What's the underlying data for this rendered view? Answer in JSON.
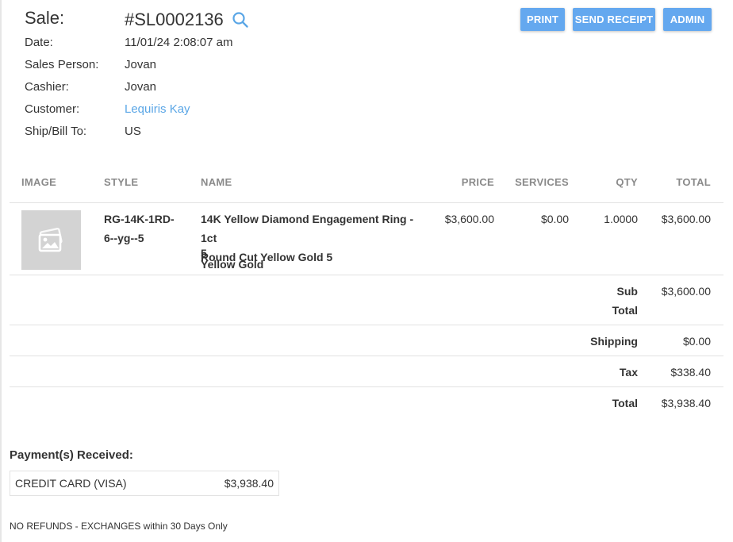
{
  "sale": {
    "label": "Sale:",
    "id": "#SL0002136"
  },
  "details": [
    {
      "key": "Date:",
      "value": "11/01/24 2:08:07 am"
    },
    {
      "key": "Sales Person:",
      "value": "Jovan"
    },
    {
      "key": "Cashier:",
      "value": "Jovan"
    },
    {
      "key": "Customer:",
      "value": "Lequiris Kay"
    },
    {
      "key": "Ship/Bill To:",
      "value": "US"
    }
  ],
  "actions": {
    "print": "PRINT",
    "send_receipt": "SEND RECEIPT",
    "admin": "ADMIN"
  },
  "table": {
    "headers": {
      "image": "IMAGE",
      "style": "STYLE",
      "name": "NAME",
      "price": "PRICE",
      "services": "SERVICES",
      "qty": "QTY",
      "total": "TOTAL"
    },
    "rows": [
      {
        "style_line1": "RG-14K-1RD-",
        "style_line2": "6--yg--5",
        "name_line1": "14K Yellow Diamond Engagement Ring - 1ct",
        "name_line2": "Round Cut Yellow Gold 5",
        "size": "5",
        "metal": "Yellow Gold",
        "price": "$3,600.00",
        "services": "$0.00",
        "qty": "1.0000",
        "total": "$3,600.00"
      }
    ]
  },
  "summary": {
    "subtotal_label_1": "Sub",
    "subtotal_label_2": "Total",
    "subtotal": "$3,600.00",
    "shipping_label": "Shipping",
    "shipping": "$0.00",
    "tax_label": "Tax",
    "tax": "$338.40",
    "total_label": "Total",
    "total": "$3,938.40"
  },
  "payments": {
    "title": "Payment(s) Received:",
    "items": [
      {
        "method": "CREDIT CARD (VISA)",
        "amount": "$3,938.40"
      }
    ]
  },
  "footer": {
    "note": "NO REFUNDS - EXCHANGES within 30 Days Only"
  },
  "colors": {
    "button": "#64a8ef",
    "link": "#5aa6e6",
    "header_text": "#8a8a8a"
  },
  "icons": {
    "search": "search-icon",
    "image_placeholder": "image-placeholder-icon"
  }
}
